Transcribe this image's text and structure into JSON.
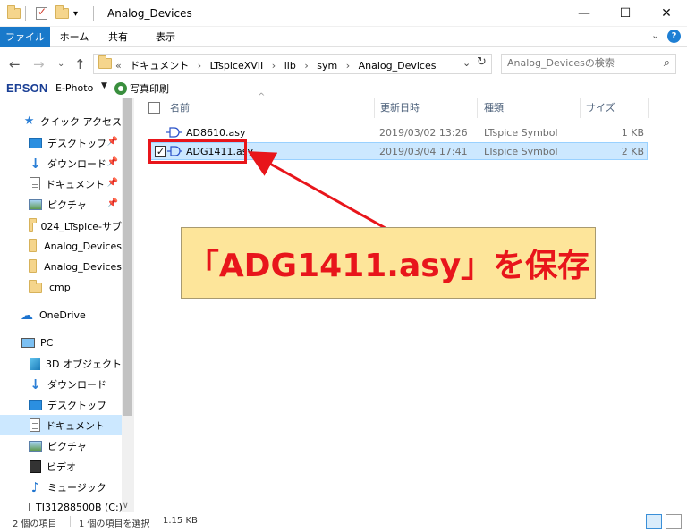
{
  "window": {
    "title": "Analog_Devices",
    "controls": {
      "minimize": "—",
      "maximize": "☐",
      "close": "✕"
    }
  },
  "ribbon": {
    "tabs": [
      "ファイル",
      "ホーム",
      "共有",
      "表示"
    ],
    "expand_icon": "chevron-down-icon",
    "help_icon": "?"
  },
  "addressbar": {
    "crumbs": [
      "ドキュメント",
      "LTspiceXVII",
      "lib",
      "sym",
      "Analog_Devices"
    ],
    "overflow": "«"
  },
  "search": {
    "placeholder": "Analog_Devicesの検索"
  },
  "epson_bar": {
    "logo": "EPSON",
    "app": "E-Photo",
    "print": "写真印刷"
  },
  "nav": {
    "quick_access": "クイック アクセス",
    "quick_items": [
      {
        "label": "デスクトップ",
        "icon": "desktop-icon",
        "pinned": true
      },
      {
        "label": "ダウンロード",
        "icon": "download-icon",
        "pinned": true
      },
      {
        "label": "ドキュメント",
        "icon": "document-icon",
        "pinned": true
      },
      {
        "label": "ピクチャ",
        "icon": "pictures-icon",
        "pinned": true
      },
      {
        "label": "024_LTspice-サブ",
        "icon": "folder-icon",
        "pinned": false
      },
      {
        "label": "Analog_Devices",
        "icon": "folder-icon",
        "pinned": false
      },
      {
        "label": "Analog_Devices",
        "icon": "folder-icon",
        "pinned": false
      },
      {
        "label": "cmp",
        "icon": "folder-icon",
        "pinned": false
      }
    ],
    "onedrive": "OneDrive",
    "pc": "PC",
    "pc_items": [
      {
        "label": "3D オブジェクト",
        "icon": "3d-objects-icon"
      },
      {
        "label": "ダウンロード",
        "icon": "download-icon"
      },
      {
        "label": "デスクトップ",
        "icon": "desktop-icon"
      },
      {
        "label": "ドキュメント",
        "icon": "document-icon",
        "selected": true
      },
      {
        "label": "ピクチャ",
        "icon": "pictures-icon"
      },
      {
        "label": "ビデオ",
        "icon": "video-icon"
      },
      {
        "label": "ミュージック",
        "icon": "music-icon"
      },
      {
        "label": "TI31288500B (C:)",
        "icon": "drive-icon"
      }
    ]
  },
  "filelist": {
    "columns": {
      "name": "名前",
      "date": "更新日時",
      "type": "種類",
      "size": "サイズ"
    },
    "rows": [
      {
        "name": "AD8610.asy",
        "date": "2019/03/02 13:26",
        "type": "LTspice Symbol",
        "size": "1 KB",
        "selected": false
      },
      {
        "name": "ADG1411.asy",
        "date": "2019/03/04 17:41",
        "type": "LTspice Symbol",
        "size": "2 KB",
        "selected": true
      }
    ]
  },
  "annotation": {
    "text": "「ADG1411.asy」を保存"
  },
  "status": {
    "count": "2 個の項目",
    "selected": "1 個の項目を選択",
    "size": "1.15 KB"
  },
  "colors": {
    "accent": "#1979ca",
    "selection": "#cce8ff",
    "annotation_red": "#e8151b",
    "callout_bg": "#fde59a"
  }
}
